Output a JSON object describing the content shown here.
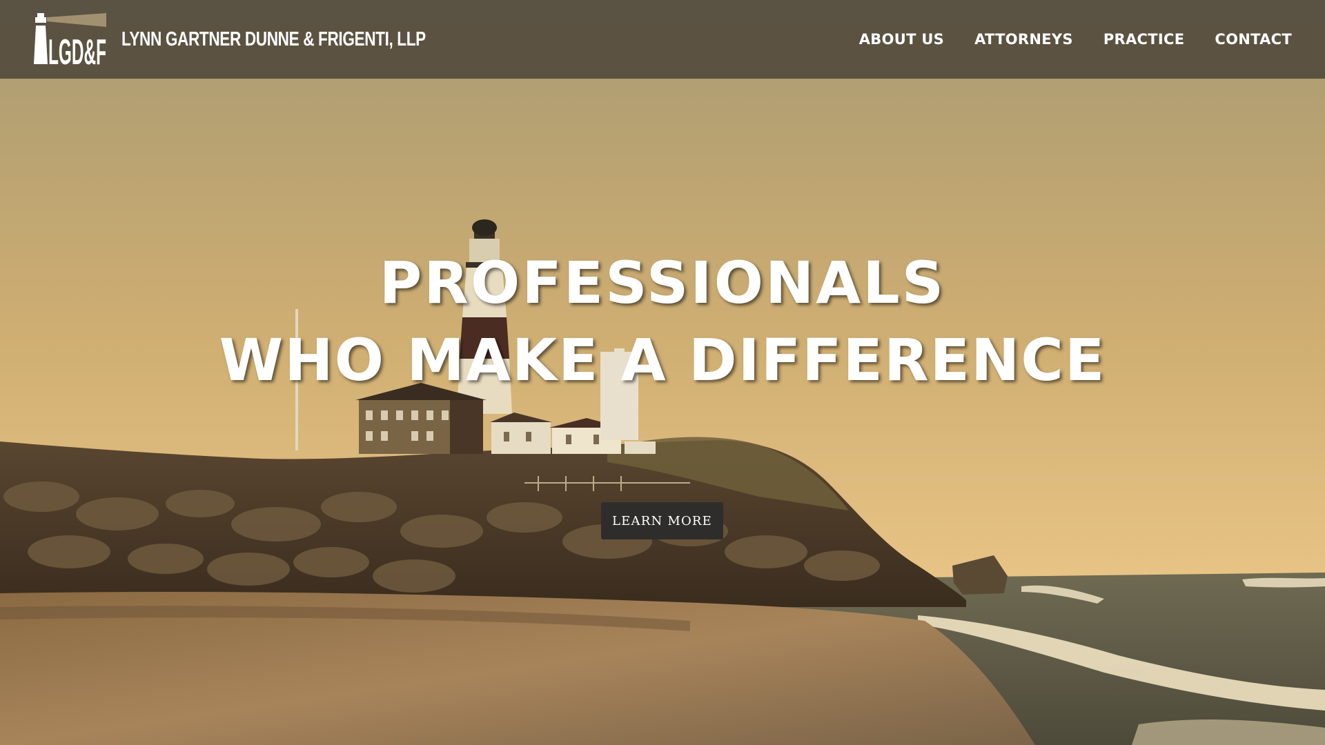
{
  "header": {
    "logo_alt": "LGD&F",
    "firm_name": "LYNN GARTNER DUNNE & FRIGENTI, LLP",
    "nav": [
      {
        "label": "ABOUT US"
      },
      {
        "label": "ATTORNEYS"
      },
      {
        "label": "PRACTICE"
      },
      {
        "label": "CONTACT"
      }
    ]
  },
  "hero": {
    "headline_line1": "PROFESSIONALS",
    "headline_line2": "WHO MAKE A DIFFERENCE",
    "cta_label": "LEARN MORE",
    "background": "sepia lighthouse on a rocky bluff above the beach"
  },
  "colors": {
    "header_bg": "#585040",
    "sky_top": "#a89a72",
    "sky_bottom": "#e6c07e",
    "cta_bg": "#2e2d2b",
    "text": "#ffffff"
  }
}
